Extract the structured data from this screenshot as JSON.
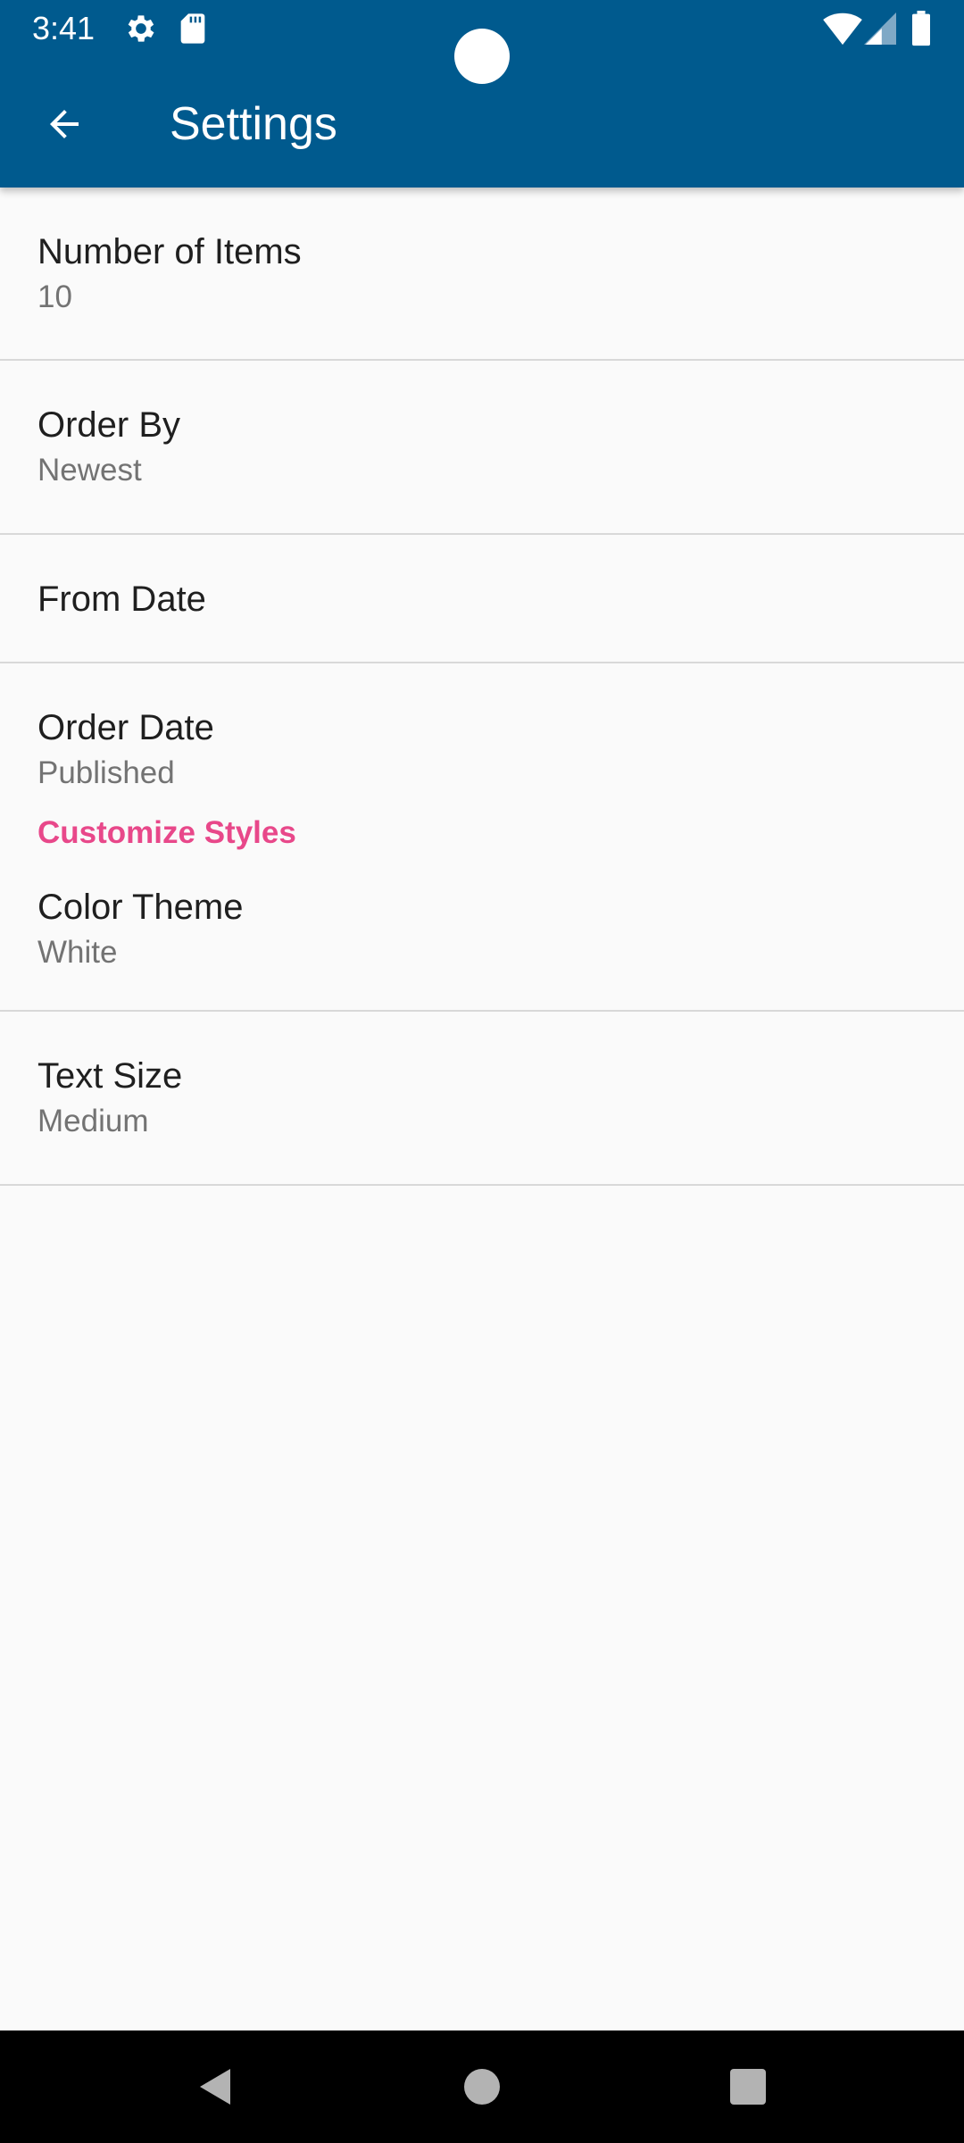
{
  "status_bar": {
    "time": "3:41",
    "icons": [
      "settings-icon",
      "sd-card-icon",
      "wifi-icon",
      "cell-signal-icon",
      "battery-icon"
    ]
  },
  "appbar": {
    "title": "Settings",
    "back_icon": "arrow-back-icon",
    "color": "#005a8e"
  },
  "preferences": [
    {
      "title": "Number of Items",
      "summary": "10"
    },
    {
      "title": "Order By",
      "summary": "Newest"
    },
    {
      "title": "From Date",
      "summary": ""
    },
    {
      "title": "Order Date",
      "summary": "Published"
    }
  ],
  "category": {
    "title": "Customize Styles",
    "color": "#e8488a",
    "items": [
      {
        "title": "Color Theme",
        "summary": "White"
      },
      {
        "title": "Text Size",
        "summary": "Medium"
      }
    ]
  },
  "nav_bar": {
    "buttons": [
      "back-triangle-icon",
      "home-circle-icon",
      "recents-square-icon"
    ]
  }
}
